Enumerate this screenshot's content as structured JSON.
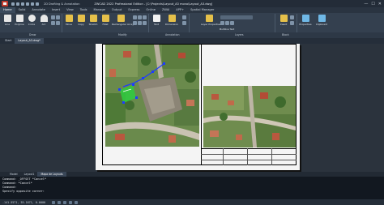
{
  "titlebar": {
    "workspace": "2D Drafting & Annotation",
    "title": "ZWCAD 2022 Professional Edition - [C:\\Projects\\Layout_A3 mono\\Layout_A3.dwg]",
    "minimize": "—",
    "maximize": "☐",
    "close": "✕"
  },
  "menu_tabs": [
    "Home",
    "Solid",
    "Annotate",
    "Insert",
    "View",
    "Tools",
    "Manage",
    "Output",
    "Express",
    "Online",
    "ZWAI",
    "APP+",
    "Spatial Manager"
  ],
  "ribbon": {
    "tools": [
      {
        "label": "Line",
        "color": "#e8e8e8"
      },
      {
        "label": "Polyline",
        "color": "#e8e8e8"
      },
      {
        "label": "Circle",
        "color": "#e8e8e8"
      },
      {
        "label": "Arc",
        "color": "#e8e8e8"
      },
      {
        "label": "Move",
        "color": "#e5c04a"
      },
      {
        "label": "Copy",
        "color": "#e5c04a"
      },
      {
        "label": "Stretch",
        "color": "#e5c04a"
      },
      {
        "label": "Fillet",
        "color": "#e5c04a"
      },
      {
        "label": "Rectangular Array",
        "color": "#e5c04a"
      },
      {
        "label": "Text",
        "color": "#f2f2f2"
      },
      {
        "label": "Dimension",
        "color": "#e5c04a"
      },
      {
        "label": "Layer Properties",
        "color": "#e5c04a"
      },
      {
        "label": "Multiline Text",
        "color": "#f2f2f2"
      },
      {
        "label": "Insert",
        "color": "#e5c04a"
      },
      {
        "label": "Properties",
        "color": "#6fb8e6"
      },
      {
        "label": "Clipboard",
        "color": "#6fb8e6"
      }
    ],
    "groups": [
      "Draw",
      "Modify",
      "Annotation",
      "Layers",
      "Block"
    ]
  },
  "doc_tabs": [
    "Start",
    "Layout_A3.dwg*"
  ],
  "bottom_tabs": [
    "Model",
    "Layout1",
    "Mapa de Layouts"
  ],
  "command": {
    "lines": [
      "Command: _OFFSET *Cancel*",
      "Command: *Cancel*",
      "Command:",
      "Specify opposite corner:"
    ]
  },
  "status": {
    "coords": "-141.5571, 55.1671, 0.0000"
  },
  "colors": {
    "selection": "#2ecc40",
    "grip": "#1e3cff",
    "aerial_green": "#4f7a37",
    "paper": "#f4f4f4"
  }
}
